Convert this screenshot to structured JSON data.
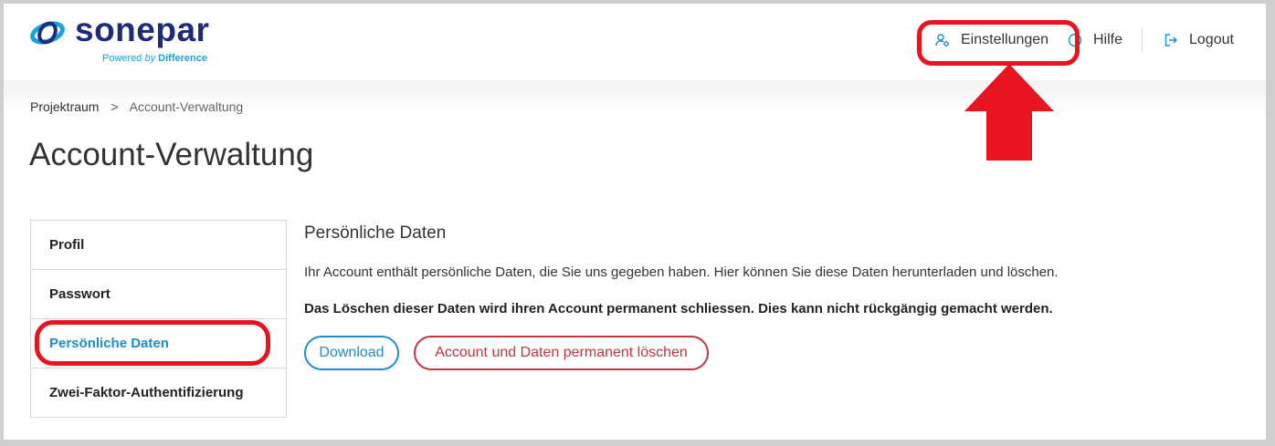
{
  "brand": {
    "name": "sonepar",
    "tagline_prefix": "Powered",
    "tagline_by": "by",
    "tagline_suffix": "Difference",
    "icon": "sonepar-logo-icon"
  },
  "header": {
    "nav": [
      {
        "label": "Einstellungen",
        "icon": "user-settings-icon"
      },
      {
        "label": "Hilfe",
        "icon": "help-circle-icon"
      },
      {
        "label": "Logout",
        "icon": "logout-icon"
      }
    ]
  },
  "breadcrumb": {
    "items": [
      "Projektraum",
      "Account-Verwaltung"
    ],
    "separator": ">"
  },
  "page": {
    "title": "Account-Verwaltung"
  },
  "sidebar": {
    "items": [
      {
        "label": "Profil",
        "active": false
      },
      {
        "label": "Passwort",
        "active": false
      },
      {
        "label": "Persönliche Daten",
        "active": true
      },
      {
        "label": "Zwei-Faktor-Authentifizierung",
        "active": false
      }
    ]
  },
  "section": {
    "title": "Persönliche Daten",
    "description": "Ihr Account enthält persönliche Daten, die Sie uns gegeben haben. Hier können Sie diese Daten herunterladen und löschen.",
    "warning": "Das Löschen dieser Daten wird ihren Account permanent schliessen. Dies kann nicht rückgängig gemacht werden.",
    "download_label": "Download",
    "delete_label": "Account und Daten permanent löschen"
  },
  "colors": {
    "accent": "#1a8ed1",
    "danger": "#c9323f",
    "brand_dark": "#1e2b7a",
    "annotation": "#e8141f"
  }
}
